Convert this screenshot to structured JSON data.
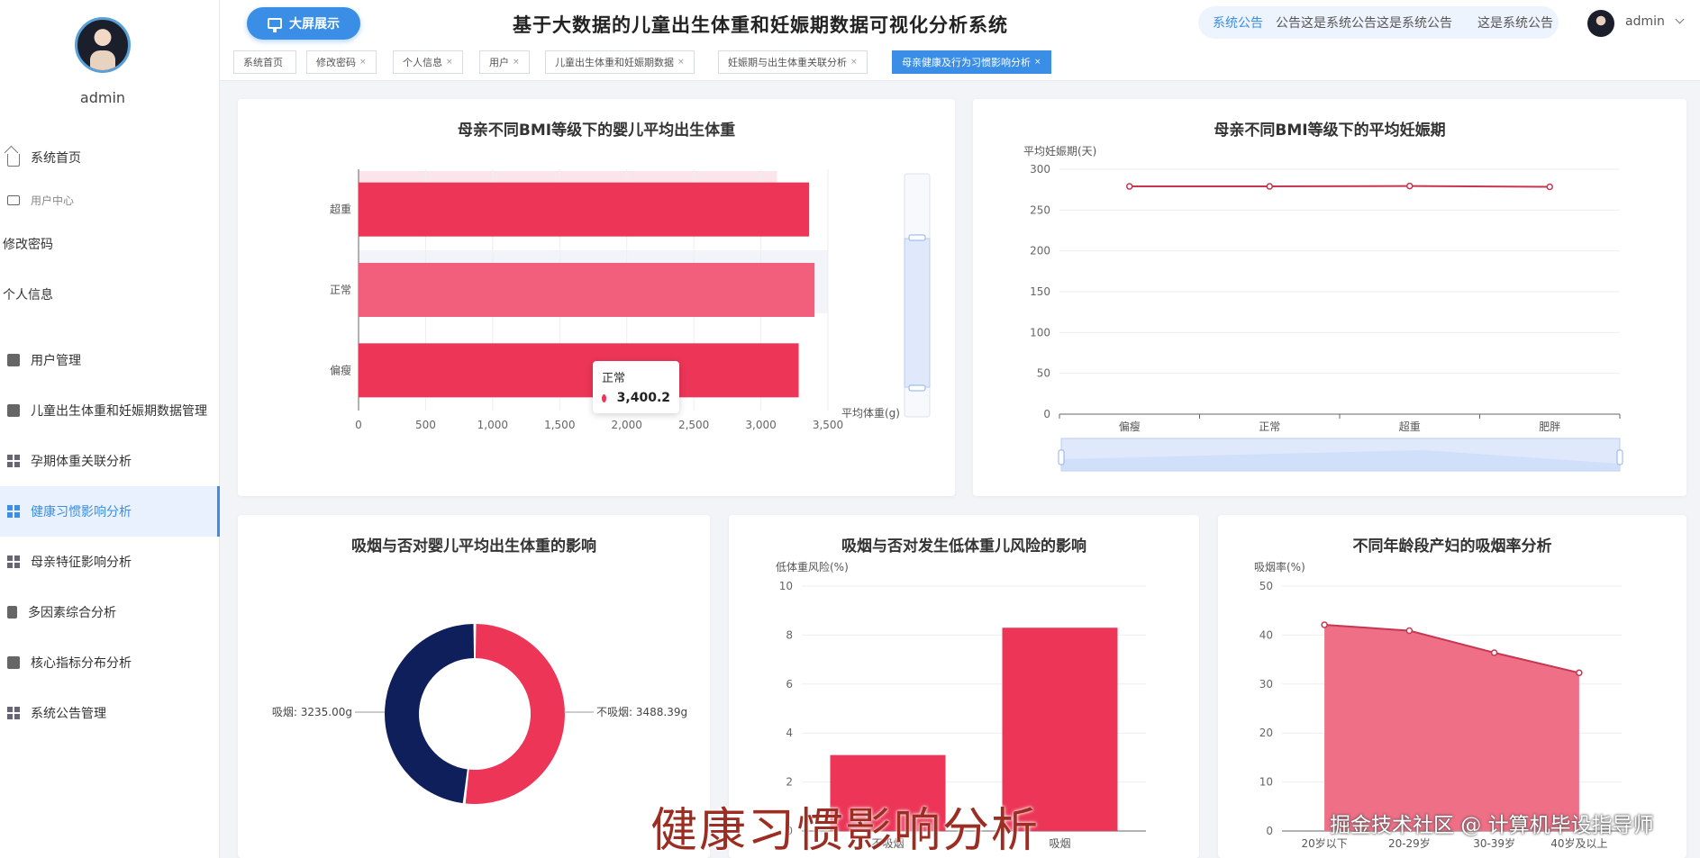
{
  "sidebar": {
    "username": "admin",
    "items": [
      {
        "label": "系统首页"
      },
      {
        "label": "用户中心"
      },
      {
        "label": "修改密码"
      },
      {
        "label": "个人信息"
      },
      {
        "label": "用户管理"
      },
      {
        "label": "儿童出生体重和妊娠期数据管理"
      },
      {
        "label": "孕期体重关联分析"
      },
      {
        "label": "健康习惯影响分析"
      },
      {
        "label": "母亲特征影响分析"
      },
      {
        "label": "多因素综合分析"
      },
      {
        "label": "核心指标分布分析"
      },
      {
        "label": "系统公告管理"
      }
    ]
  },
  "header": {
    "big_screen_label": "大屏展示",
    "title": "基于大数据的儿童出生体重和妊娠期数据可视化分析系统",
    "notice_label": "系统公告",
    "notice_text": "公告这是系统公告这是系统公告　　这是系统公告",
    "username": "admin"
  },
  "tabs": [
    {
      "label": "系统首页",
      "closable": ""
    },
    {
      "label": "修改密码",
      "closable": "×"
    },
    {
      "label": "个人信息",
      "closable": "×"
    },
    {
      "label": "用户",
      "closable": "×"
    },
    {
      "label": "儿童出生体重和妊娠期数据",
      "closable": "×"
    },
    {
      "label": "妊娠期与出生体重关联分析",
      "closable": "×"
    },
    {
      "label": "母亲健康及行为习惯影响分析",
      "closable": "×"
    }
  ],
  "tooltip": {
    "name": "正常",
    "value": "3,400.2"
  },
  "watermark": {
    "main": "健康习惯影响分析",
    "sub": "掘金技术社区 @ 计算机毕设指导师"
  },
  "colors": {
    "accent": "#3a8ee6",
    "red": "#ec3557",
    "pink": "#f25f7c",
    "navy": "#0f1f5c"
  },
  "chart_data": [
    {
      "type": "bar",
      "orientation": "horizontal",
      "title": "母亲不同BMI等级下的婴儿平均出生体重",
      "categories": [
        "偏瘦",
        "正常",
        "超重"
      ],
      "values": [
        3282,
        3400.2,
        3360
      ],
      "xlabel": "平均体重(g)",
      "xlim": [
        0,
        3500
      ],
      "ticks": [
        "0",
        "500",
        "1,000",
        "1,500",
        "2,000",
        "2,500",
        "3,000",
        "3,500"
      ],
      "grid": true
    },
    {
      "type": "line",
      "title": "母亲不同BMI等级下的平均妊娠期",
      "categories": [
        "偏瘦",
        "正常",
        "超重",
        "肥胖"
      ],
      "values": [
        279,
        279,
        279.5,
        278.5
      ],
      "ylabel": "平均妊娠期(天)",
      "ylim": [
        0,
        300
      ],
      "ticks": [
        "0",
        "50",
        "100",
        "150",
        "200",
        "250",
        "300"
      ],
      "grid": true
    },
    {
      "type": "pie",
      "title": "吸烟与否对婴儿平均出生体重的影响",
      "categories": [
        "吸烟",
        "不吸烟"
      ],
      "values": [
        3235.0,
        3488.39
      ],
      "labels": [
        "吸烟: 3235.00g",
        "不吸烟: 3488.39g"
      ]
    },
    {
      "type": "bar",
      "title": "吸烟与否对发生低体重儿风险的影响",
      "categories": [
        "不吸烟",
        "吸烟"
      ],
      "values": [
        3.1,
        8.3
      ],
      "ylabel": "低体重风险(%)",
      "ylim": [
        0,
        10
      ],
      "ticks": [
        "0",
        "2",
        "4",
        "6",
        "8",
        "10"
      ],
      "grid": true
    },
    {
      "type": "area",
      "title": "不同年龄段产妇的吸烟率分析",
      "categories": [
        "20岁以下",
        "20-29岁",
        "30-39岁",
        "40岁及以上"
      ],
      "values": [
        42.1,
        40.9,
        36.4,
        32.3
      ],
      "ylabel": "吸烟率(%)",
      "ylim": [
        0,
        50
      ],
      "ticks": [
        "0",
        "10",
        "20",
        "30",
        "40",
        "50"
      ],
      "grid": true
    }
  ]
}
